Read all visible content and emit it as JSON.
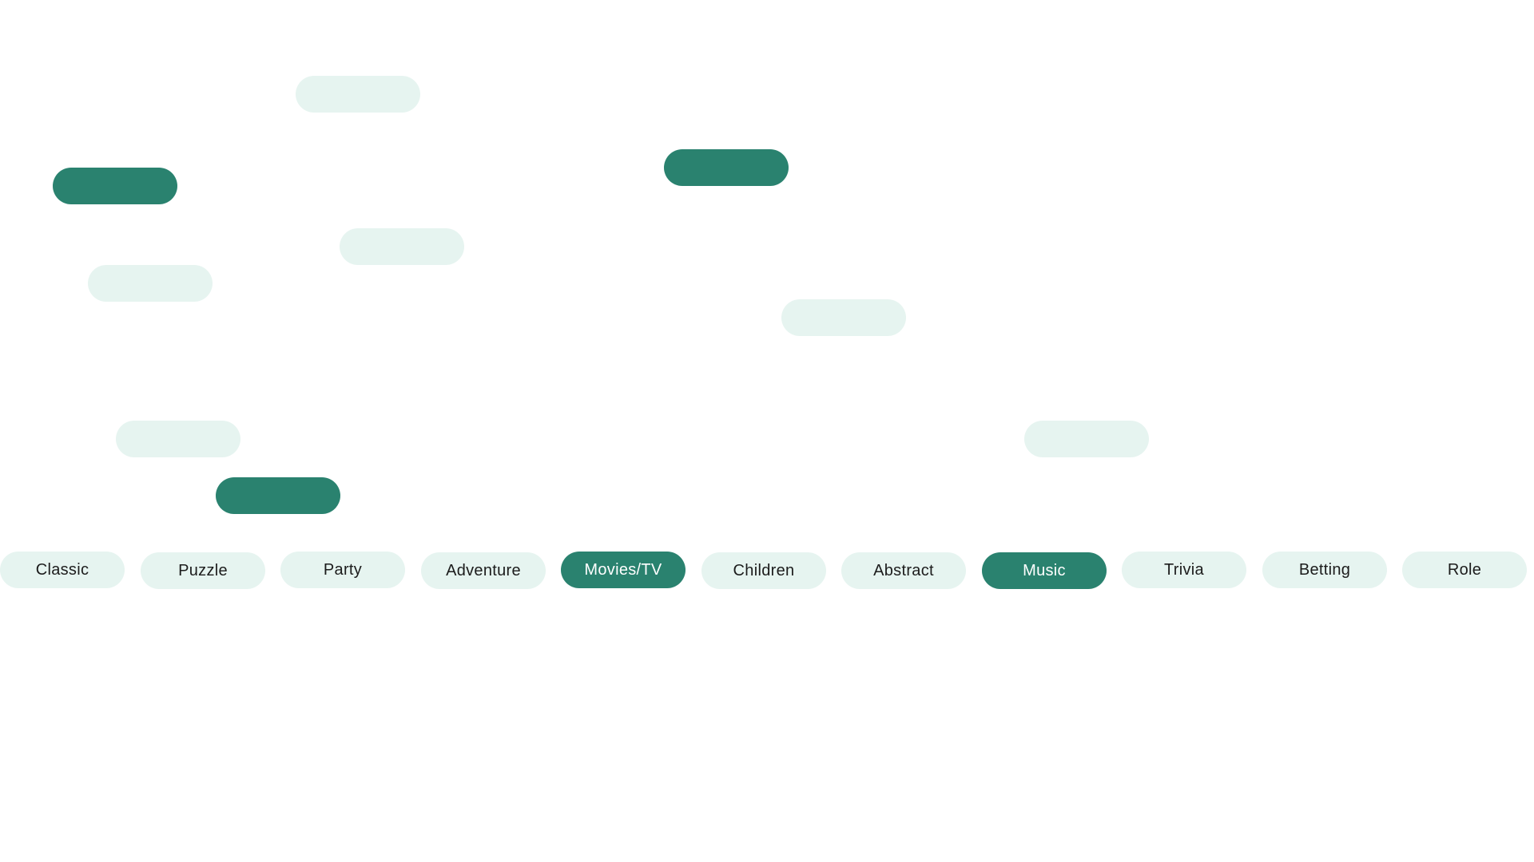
{
  "colors": {
    "selected_bg": "#2a826f",
    "selected_text": "#ffffff",
    "unselected_bg": "#e6f4f0",
    "unselected_text": "#1c1c1c"
  },
  "floating_chips": [
    {
      "label": "",
      "selected": false
    },
    {
      "label": "",
      "selected": true
    },
    {
      "label": "",
      "selected": true
    },
    {
      "label": "",
      "selected": false
    },
    {
      "label": "",
      "selected": false
    },
    {
      "label": "",
      "selected": false
    },
    {
      "label": "",
      "selected": false
    },
    {
      "label": "",
      "selected": false
    },
    {
      "label": "",
      "selected": true
    }
  ],
  "categories": [
    {
      "label": "Classic",
      "selected": false
    },
    {
      "label": "Puzzle",
      "selected": false
    },
    {
      "label": "Party",
      "selected": false
    },
    {
      "label": "Adventure",
      "selected": false
    },
    {
      "label": "Movies/TV",
      "selected": true
    },
    {
      "label": "Children",
      "selected": false
    },
    {
      "label": "Abstract",
      "selected": false
    },
    {
      "label": "Music",
      "selected": true
    },
    {
      "label": "Trivia",
      "selected": false
    },
    {
      "label": "Betting",
      "selected": false
    },
    {
      "label": "Role",
      "selected": false
    }
  ]
}
